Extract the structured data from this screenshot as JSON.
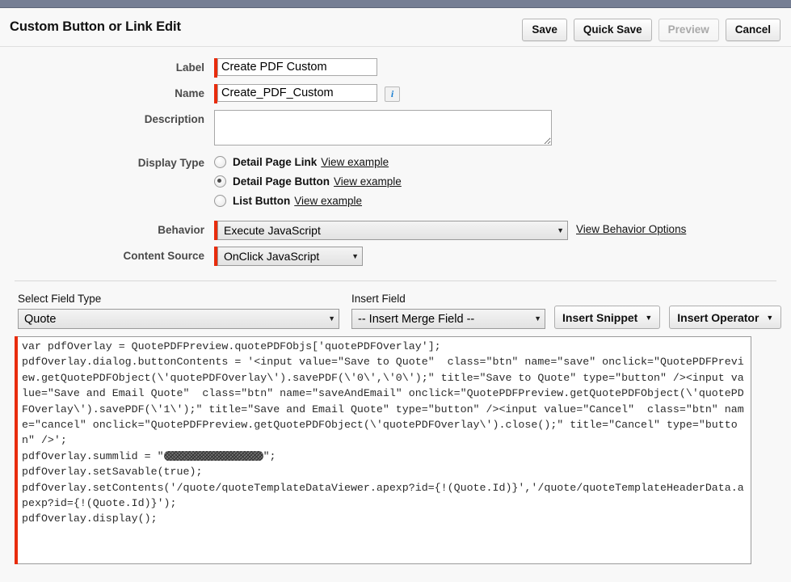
{
  "header": {
    "title": "Custom Button or Link Edit",
    "buttons": [
      {
        "label": "Save",
        "disabled": false
      },
      {
        "label": "Quick Save",
        "disabled": false
      },
      {
        "label": "Preview",
        "disabled": true
      },
      {
        "label": "Cancel",
        "disabled": false
      }
    ]
  },
  "form": {
    "label_caption": "Label",
    "label_value": "Create PDF Custom",
    "name_caption": "Name",
    "name_value": "Create_PDF_Custom",
    "name_info_icon": "info-icon",
    "description_caption": "Description",
    "description_value": "",
    "display_type_caption": "Display Type",
    "display_type_options": [
      {
        "label": "Detail Page Link",
        "link": "View example",
        "selected": false
      },
      {
        "label": "Detail Page Button",
        "link": "View example",
        "selected": true
      },
      {
        "label": "List Button",
        "link": "View example",
        "selected": false
      }
    ],
    "behavior_caption": "Behavior",
    "behavior_value": "Execute JavaScript",
    "behavior_link": "View Behavior Options",
    "content_source_caption": "Content Source",
    "content_source_value": "OnClick JavaScript"
  },
  "editor": {
    "select_field_type_caption": "Select Field Type",
    "select_field_type_value": "Quote",
    "insert_field_caption": "Insert Field",
    "insert_field_value": "-- Insert Merge Field --",
    "insert_snippet_label": "Insert Snippet",
    "insert_operator_label": "Insert Operator",
    "caret_glyph": "▼",
    "code_part_1": "var pdfOverlay = QuotePDFPreview.quotePDFObjs['quotePDFOverlay'];\npdfOverlay.dialog.buttonContents = '<input value=\"Save to Quote\"  class=\"btn\" name=\"save\" onclick=\"QuotePDFPreview.getQuotePDFObject(\\'quotePDFOverlay\\').savePDF(\\'0\\',\\'0\\');\" title=\"Save to Quote\" type=\"button\" /><input value=\"Save and Email Quote\"  class=\"btn\" name=\"saveAndEmail\" onclick=\"QuotePDFPreview.getQuotePDFObject(\\'quotePDFOverlay\\').savePDF(\\'1\\');\" title=\"Save and Email Quote\" type=\"button\" /><input value=\"Cancel\"  class=\"btn\" name=\"cancel\" onclick=\"QuotePDFPreview.getQuotePDFObject(\\'quotePDFOverlay\\').close();\" title=\"Cancel\" type=\"button\" />';\npdfOverlay.summlid = \"",
    "code_redacted": "[redacted]",
    "code_part_2": "\";\npdfOverlay.setSavable(true);\npdfOverlay.setContents('/quote/quoteTemplateDataViewer.apexp?id={!(Quote.Id)}','/quote/quoteTemplateHeaderData.apexp?id={!(Quote.Id)}');\npdfOverlay.display();"
  },
  "colors": {
    "top_bar": "#767f94",
    "required_marker": "#e82c0c",
    "info_icon": "#1b7fd1"
  }
}
